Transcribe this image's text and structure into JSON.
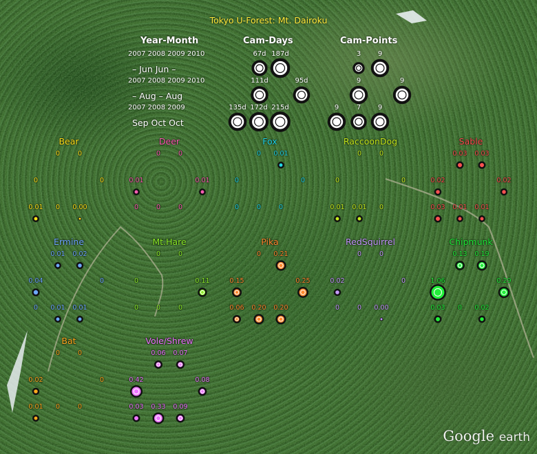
{
  "title": "Tokyo U-Forest: Mt. Dairoku",
  "logo": {
    "brand": "Google",
    "product": "earth"
  },
  "headers": {
    "period": "Year-Month",
    "camdays": "Cam-Days",
    "campoints": "Cam-Points"
  },
  "colors": {
    "title": "#ffea3a",
    "marker_ring": "#ffffff"
  },
  "effort_rows": [
    {
      "years": "2007 2008 2009 2010",
      "months": "–   Jun  Jun   –",
      "camdays": [
        "",
        "",
        "67d",
        "187d"
      ],
      "camdays_size": [
        0,
        0,
        67,
        187
      ],
      "campoints": [
        "",
        "",
        "3",
        "9"
      ],
      "campoints_size": [
        0,
        0,
        3,
        9
      ]
    },
    {
      "years": "2007 2008 2009 2010",
      "months": "–   Aug   –   Aug",
      "camdays": [
        "",
        "111d",
        "",
        "95d"
      ],
      "camdays_size": [
        0,
        111,
        0,
        95
      ],
      "campoints": [
        "",
        "9",
        "",
        "9"
      ],
      "campoints_size": [
        0,
        9,
        0,
        9
      ]
    },
    {
      "years": "2007 2008 2009",
      "months": "Sep  Oct  Oct",
      "camdays": [
        "135d",
        "172d",
        "215d"
      ],
      "camdays_size": [
        135,
        172,
        215
      ],
      "campoints": [
        "9",
        "7",
        "9"
      ],
      "campoints_size": [
        9,
        7,
        9
      ]
    }
  ],
  "species": [
    {
      "name": "Bear",
      "color": "#ffe21a",
      "rows": [
        [
          "",
          "0",
          "0",
          ""
        ],
        [
          "0",
          "",
          "",
          "0"
        ],
        [
          "0.01",
          "0",
          "0.00"
        ]
      ]
    },
    {
      "name": "Deer",
      "color": "#ff5fb4",
      "rows": [
        [
          "",
          "0",
          "0",
          ""
        ],
        [
          "0.01",
          "",
          "",
          "0.01"
        ],
        [
          "0",
          "0",
          "0"
        ]
      ]
    },
    {
      "name": "Fox",
      "color": "#22d8e6",
      "rows": [
        [
          "",
          "0",
          "0.01",
          ""
        ],
        [
          "0",
          "",
          "",
          "0"
        ],
        [
          "0",
          "0",
          "0"
        ]
      ]
    },
    {
      "name": "RaccoonDog",
      "color": "#c6ec1e",
      "rows": [
        [
          "",
          "0",
          "0",
          ""
        ],
        [
          "0",
          "",
          "",
          "0"
        ],
        [
          "0.01",
          "0.01",
          "0"
        ]
      ]
    },
    {
      "name": "Sable",
      "color": "#ff5151",
      "rows": [
        [
          "",
          "0.03",
          "0.03",
          ""
        ],
        [
          "0.02",
          "",
          "",
          "0.02"
        ],
        [
          "0.03",
          "0.01",
          "0.01"
        ]
      ]
    },
    {
      "name": "Ermine",
      "color": "#6ea8ff",
      "rows": [
        [
          "",
          "0.01",
          "0.02",
          ""
        ],
        [
          "0.04",
          "",
          "",
          "0"
        ],
        [
          "0",
          "0.01",
          "0.01"
        ]
      ]
    },
    {
      "name": "Mt.Hare",
      "color": "#8ef02a",
      "rows": [
        [
          "",
          "0",
          "0",
          ""
        ],
        [
          "0",
          "",
          "",
          "0.11"
        ],
        [
          "0",
          "0",
          "0"
        ]
      ]
    },
    {
      "name": "Pika",
      "color": "#ff8a30",
      "rows": [
        [
          "",
          "0",
          "0.21",
          ""
        ],
        [
          "0.15",
          "",
          "",
          "0.25"
        ],
        [
          "0.06",
          "0.20",
          "0.20"
        ]
      ]
    },
    {
      "name": "RedSquirrel",
      "color": "#c79cff",
      "rows": [
        [
          "",
          "0",
          "0",
          ""
        ],
        [
          "0.02",
          "",
          "",
          "0"
        ],
        [
          "0",
          "0",
          "0.00"
        ]
      ]
    },
    {
      "name": "Chipmunk",
      "color": "#22f03a",
      "rows": [
        [
          "",
          "0.13",
          "0.19",
          ""
        ],
        [
          "1.06",
          "",
          "",
          "0.29"
        ],
        [
          "0.03",
          "0",
          "0.02"
        ]
      ]
    },
    {
      "name": "Bat",
      "color": "#ffaa1e",
      "rows": [
        [
          "",
          "0",
          "0",
          ""
        ],
        [
          "0.02",
          "",
          "",
          "0"
        ],
        [
          "0.01",
          "0",
          "0"
        ]
      ]
    },
    {
      "name": "Vole/Shrew",
      "color": "#ee77ff",
      "rows": [
        [
          "",
          "0.06",
          "0.07",
          ""
        ],
        [
          "0.42",
          "",
          "",
          "0.08"
        ],
        [
          "0.03",
          "0.33",
          "0.09"
        ]
      ]
    }
  ]
}
